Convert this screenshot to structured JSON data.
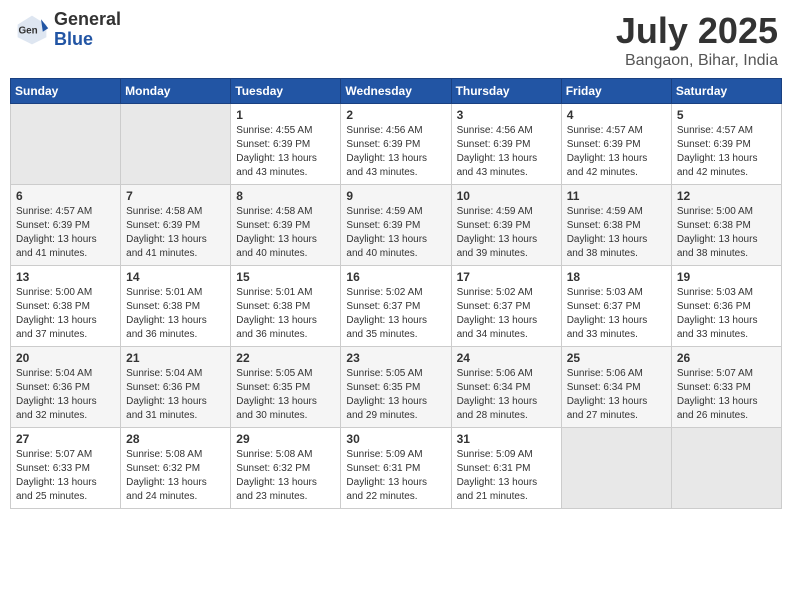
{
  "header": {
    "logo": {
      "general": "General",
      "blue": "Blue"
    },
    "title": "July 2025",
    "location": "Bangaon, Bihar, India"
  },
  "weekdays": [
    "Sunday",
    "Monday",
    "Tuesday",
    "Wednesday",
    "Thursday",
    "Friday",
    "Saturday"
  ],
  "weeks": [
    [
      {
        "day": null
      },
      {
        "day": null
      },
      {
        "day": 1,
        "sunrise": "4:55 AM",
        "sunset": "6:39 PM",
        "daylight": "13 hours and 43 minutes."
      },
      {
        "day": 2,
        "sunrise": "4:56 AM",
        "sunset": "6:39 PM",
        "daylight": "13 hours and 43 minutes."
      },
      {
        "day": 3,
        "sunrise": "4:56 AM",
        "sunset": "6:39 PM",
        "daylight": "13 hours and 43 minutes."
      },
      {
        "day": 4,
        "sunrise": "4:57 AM",
        "sunset": "6:39 PM",
        "daylight": "13 hours and 42 minutes."
      },
      {
        "day": 5,
        "sunrise": "4:57 AM",
        "sunset": "6:39 PM",
        "daylight": "13 hours and 42 minutes."
      }
    ],
    [
      {
        "day": 6,
        "sunrise": "4:57 AM",
        "sunset": "6:39 PM",
        "daylight": "13 hours and 41 minutes."
      },
      {
        "day": 7,
        "sunrise": "4:58 AM",
        "sunset": "6:39 PM",
        "daylight": "13 hours and 41 minutes."
      },
      {
        "day": 8,
        "sunrise": "4:58 AM",
        "sunset": "6:39 PM",
        "daylight": "13 hours and 40 minutes."
      },
      {
        "day": 9,
        "sunrise": "4:59 AM",
        "sunset": "6:39 PM",
        "daylight": "13 hours and 40 minutes."
      },
      {
        "day": 10,
        "sunrise": "4:59 AM",
        "sunset": "6:39 PM",
        "daylight": "13 hours and 39 minutes."
      },
      {
        "day": 11,
        "sunrise": "4:59 AM",
        "sunset": "6:38 PM",
        "daylight": "13 hours and 38 minutes."
      },
      {
        "day": 12,
        "sunrise": "5:00 AM",
        "sunset": "6:38 PM",
        "daylight": "13 hours and 38 minutes."
      }
    ],
    [
      {
        "day": 13,
        "sunrise": "5:00 AM",
        "sunset": "6:38 PM",
        "daylight": "13 hours and 37 minutes."
      },
      {
        "day": 14,
        "sunrise": "5:01 AM",
        "sunset": "6:38 PM",
        "daylight": "13 hours and 36 minutes."
      },
      {
        "day": 15,
        "sunrise": "5:01 AM",
        "sunset": "6:38 PM",
        "daylight": "13 hours and 36 minutes."
      },
      {
        "day": 16,
        "sunrise": "5:02 AM",
        "sunset": "6:37 PM",
        "daylight": "13 hours and 35 minutes."
      },
      {
        "day": 17,
        "sunrise": "5:02 AM",
        "sunset": "6:37 PM",
        "daylight": "13 hours and 34 minutes."
      },
      {
        "day": 18,
        "sunrise": "5:03 AM",
        "sunset": "6:37 PM",
        "daylight": "13 hours and 33 minutes."
      },
      {
        "day": 19,
        "sunrise": "5:03 AM",
        "sunset": "6:36 PM",
        "daylight": "13 hours and 33 minutes."
      }
    ],
    [
      {
        "day": 20,
        "sunrise": "5:04 AM",
        "sunset": "6:36 PM",
        "daylight": "13 hours and 32 minutes."
      },
      {
        "day": 21,
        "sunrise": "5:04 AM",
        "sunset": "6:36 PM",
        "daylight": "13 hours and 31 minutes."
      },
      {
        "day": 22,
        "sunrise": "5:05 AM",
        "sunset": "6:35 PM",
        "daylight": "13 hours and 30 minutes."
      },
      {
        "day": 23,
        "sunrise": "5:05 AM",
        "sunset": "6:35 PM",
        "daylight": "13 hours and 29 minutes."
      },
      {
        "day": 24,
        "sunrise": "5:06 AM",
        "sunset": "6:34 PM",
        "daylight": "13 hours and 28 minutes."
      },
      {
        "day": 25,
        "sunrise": "5:06 AM",
        "sunset": "6:34 PM",
        "daylight": "13 hours and 27 minutes."
      },
      {
        "day": 26,
        "sunrise": "5:07 AM",
        "sunset": "6:33 PM",
        "daylight": "13 hours and 26 minutes."
      }
    ],
    [
      {
        "day": 27,
        "sunrise": "5:07 AM",
        "sunset": "6:33 PM",
        "daylight": "13 hours and 25 minutes."
      },
      {
        "day": 28,
        "sunrise": "5:08 AM",
        "sunset": "6:32 PM",
        "daylight": "13 hours and 24 minutes."
      },
      {
        "day": 29,
        "sunrise": "5:08 AM",
        "sunset": "6:32 PM",
        "daylight": "13 hours and 23 minutes."
      },
      {
        "day": 30,
        "sunrise": "5:09 AM",
        "sunset": "6:31 PM",
        "daylight": "13 hours and 22 minutes."
      },
      {
        "day": 31,
        "sunrise": "5:09 AM",
        "sunset": "6:31 PM",
        "daylight": "13 hours and 21 minutes."
      },
      {
        "day": null
      },
      {
        "day": null
      }
    ]
  ]
}
